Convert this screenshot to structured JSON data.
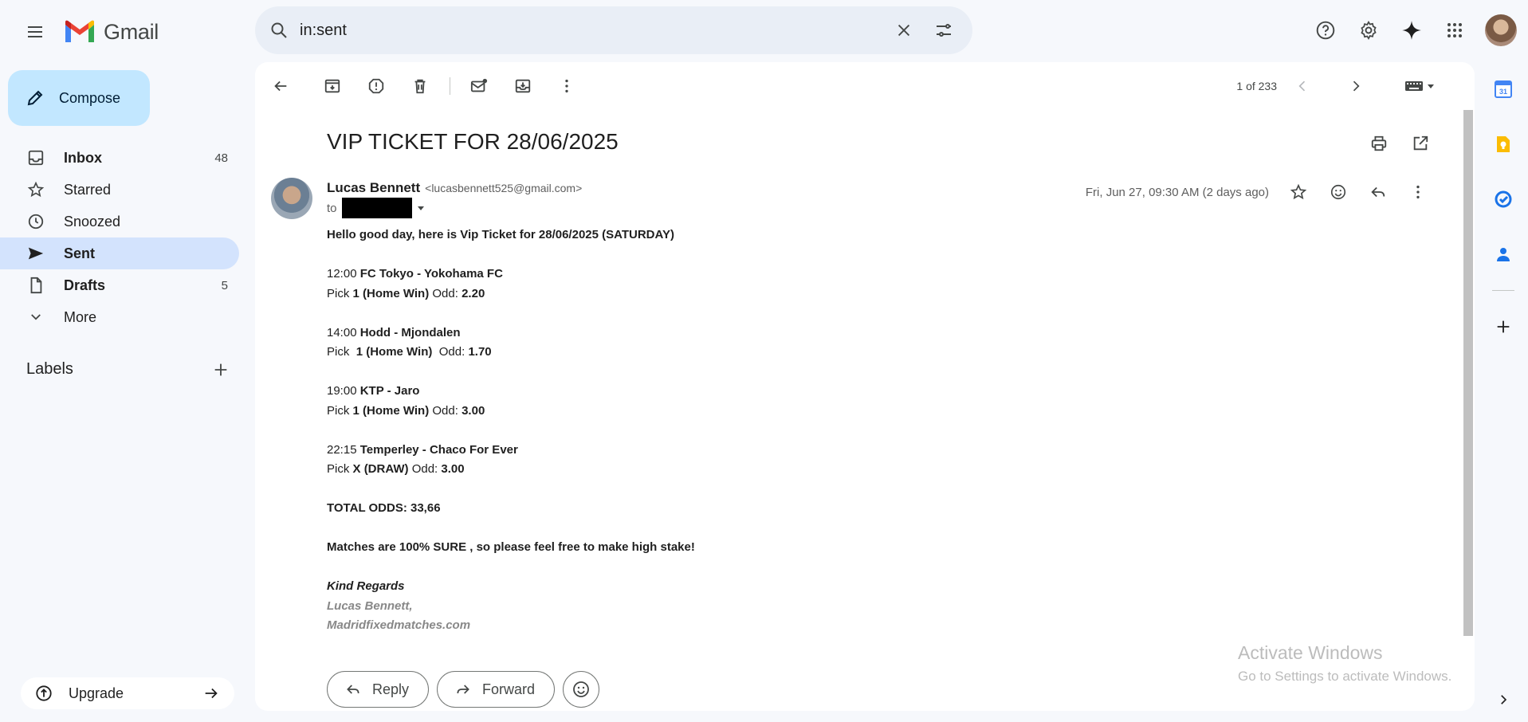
{
  "app": {
    "name": "Gmail"
  },
  "search": {
    "query": "in:sent"
  },
  "compose": {
    "label": "Compose"
  },
  "nav": [
    {
      "label": "Inbox",
      "count": "48"
    },
    {
      "label": "Starred",
      "count": ""
    },
    {
      "label": "Snoozed",
      "count": ""
    },
    {
      "label": "Sent",
      "count": ""
    },
    {
      "label": "Drafts",
      "count": "5"
    },
    {
      "label": "More",
      "count": ""
    }
  ],
  "labels_heading": "Labels",
  "upgrade": {
    "label": "Upgrade"
  },
  "pager": {
    "text": "1 of 233"
  },
  "email": {
    "subject": "VIP TICKET FOR 28/06/2025",
    "sender_name": "Lucas Bennett",
    "sender_email": "<lucasbennett525@gmail.com>",
    "to_label": "to",
    "date": "Fri, Jun 27, 09:30 AM (2 days ago)",
    "body": {
      "greeting": "Hello good day, here is Vip Ticket for 28/06/2025 (SATURDAY)",
      "matches": [
        {
          "time": "12:00",
          "teams": "FC Tokyo - Yokohama FC",
          "pick_label": "Pick",
          "pick": "1 (Home Win)",
          "odd_label": "Odd:",
          "odd": "2.20"
        },
        {
          "time": "14:00",
          "teams": "Hodd - Mjondalen",
          "pick_label": "Pick ",
          "pick": "1 (Home Win)",
          "odd_label": "Odd:",
          "odd": "1.70"
        },
        {
          "time": "19:00",
          "teams": "KTP - Jaro",
          "pick_label": "Pick",
          "pick": "1 (Home Win)",
          "odd_label": "Odd:",
          "odd": "3.00"
        },
        {
          "time": "22:15",
          "teams": "Temperley - Chaco For Ever",
          "pick_label": "Pick",
          "pick": "X (DRAW)",
          "odd_label": "Odd:",
          "odd": "3.00"
        }
      ],
      "total": "TOTAL ODDS: 33,66",
      "note": "Matches are 100% SURE , so please feel free to make high stake!",
      "closing": "Kind Regards",
      "signature_name": "Lucas Bennett,",
      "signature_site": "Madridfixedmatches.com"
    }
  },
  "actions": {
    "reply": "Reply",
    "forward": "Forward"
  },
  "watermark": {
    "title": "Activate Windows",
    "subtitle": "Go to Settings to activate Windows."
  },
  "colors": {
    "accent_blue": "#0b57d0",
    "compose_bg": "#c2e7ff",
    "active_nav": "#d3e3fd",
    "page_bg": "#f6f8fc"
  }
}
